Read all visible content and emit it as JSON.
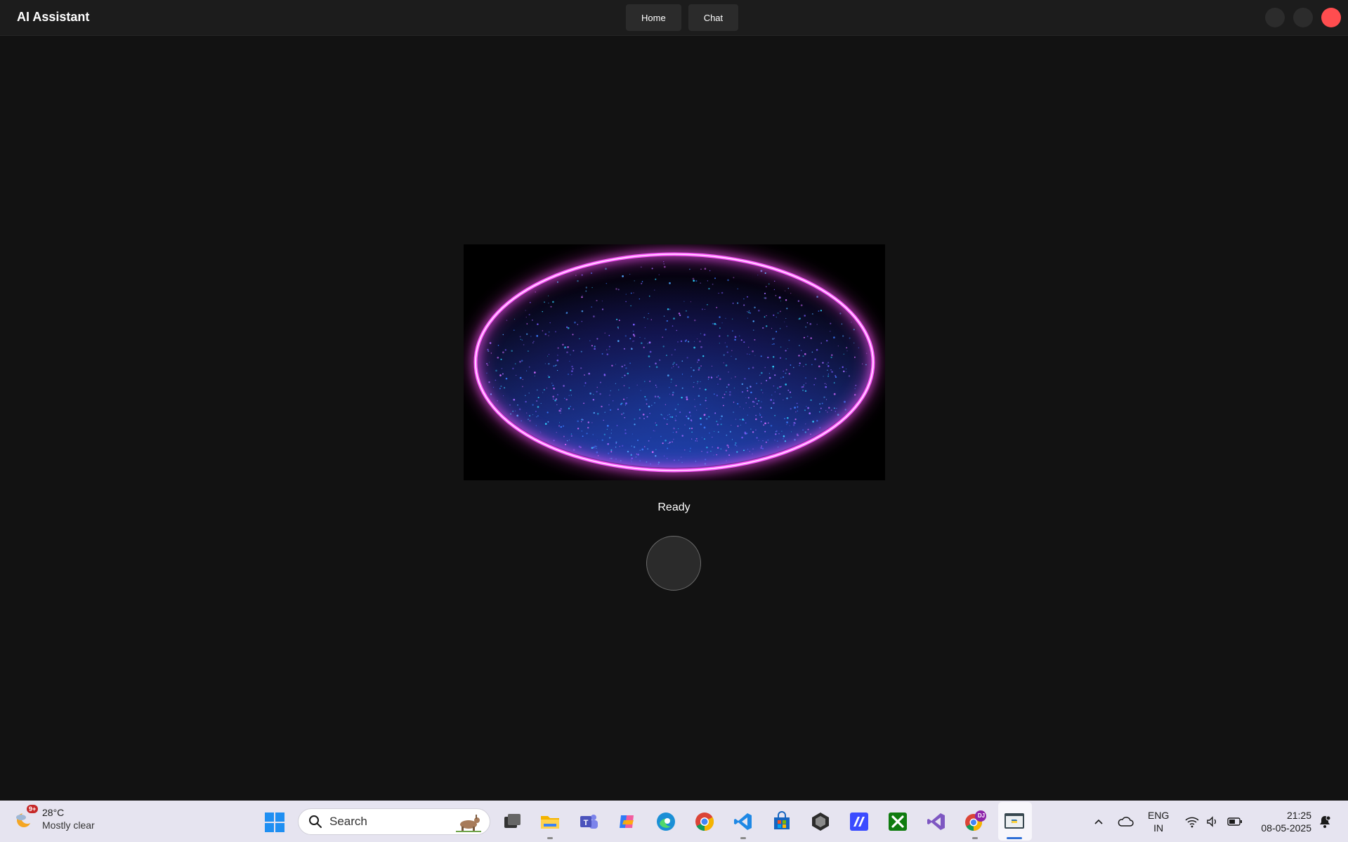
{
  "app": {
    "title": "AI Assistant",
    "nav": [
      {
        "label": "Home"
      },
      {
        "label": "Chat"
      }
    ],
    "status": "Ready",
    "colors": {
      "background": "#121212",
      "titlebar": "#1c1c1c",
      "close_button": "#ff4d4f",
      "orb_ring": "#ff40ff",
      "orb_particles": "#3a7bff"
    }
  },
  "taskbar": {
    "weather": {
      "badge": "9+",
      "temperature": "28°C",
      "condition": "Mostly clear"
    },
    "search": {
      "label": "Search"
    },
    "chrome_profile_badge": "DJ",
    "language": {
      "line1": "ENG",
      "line2": "IN"
    },
    "clock": {
      "time": "21:25",
      "date": "08-05-2025"
    }
  }
}
